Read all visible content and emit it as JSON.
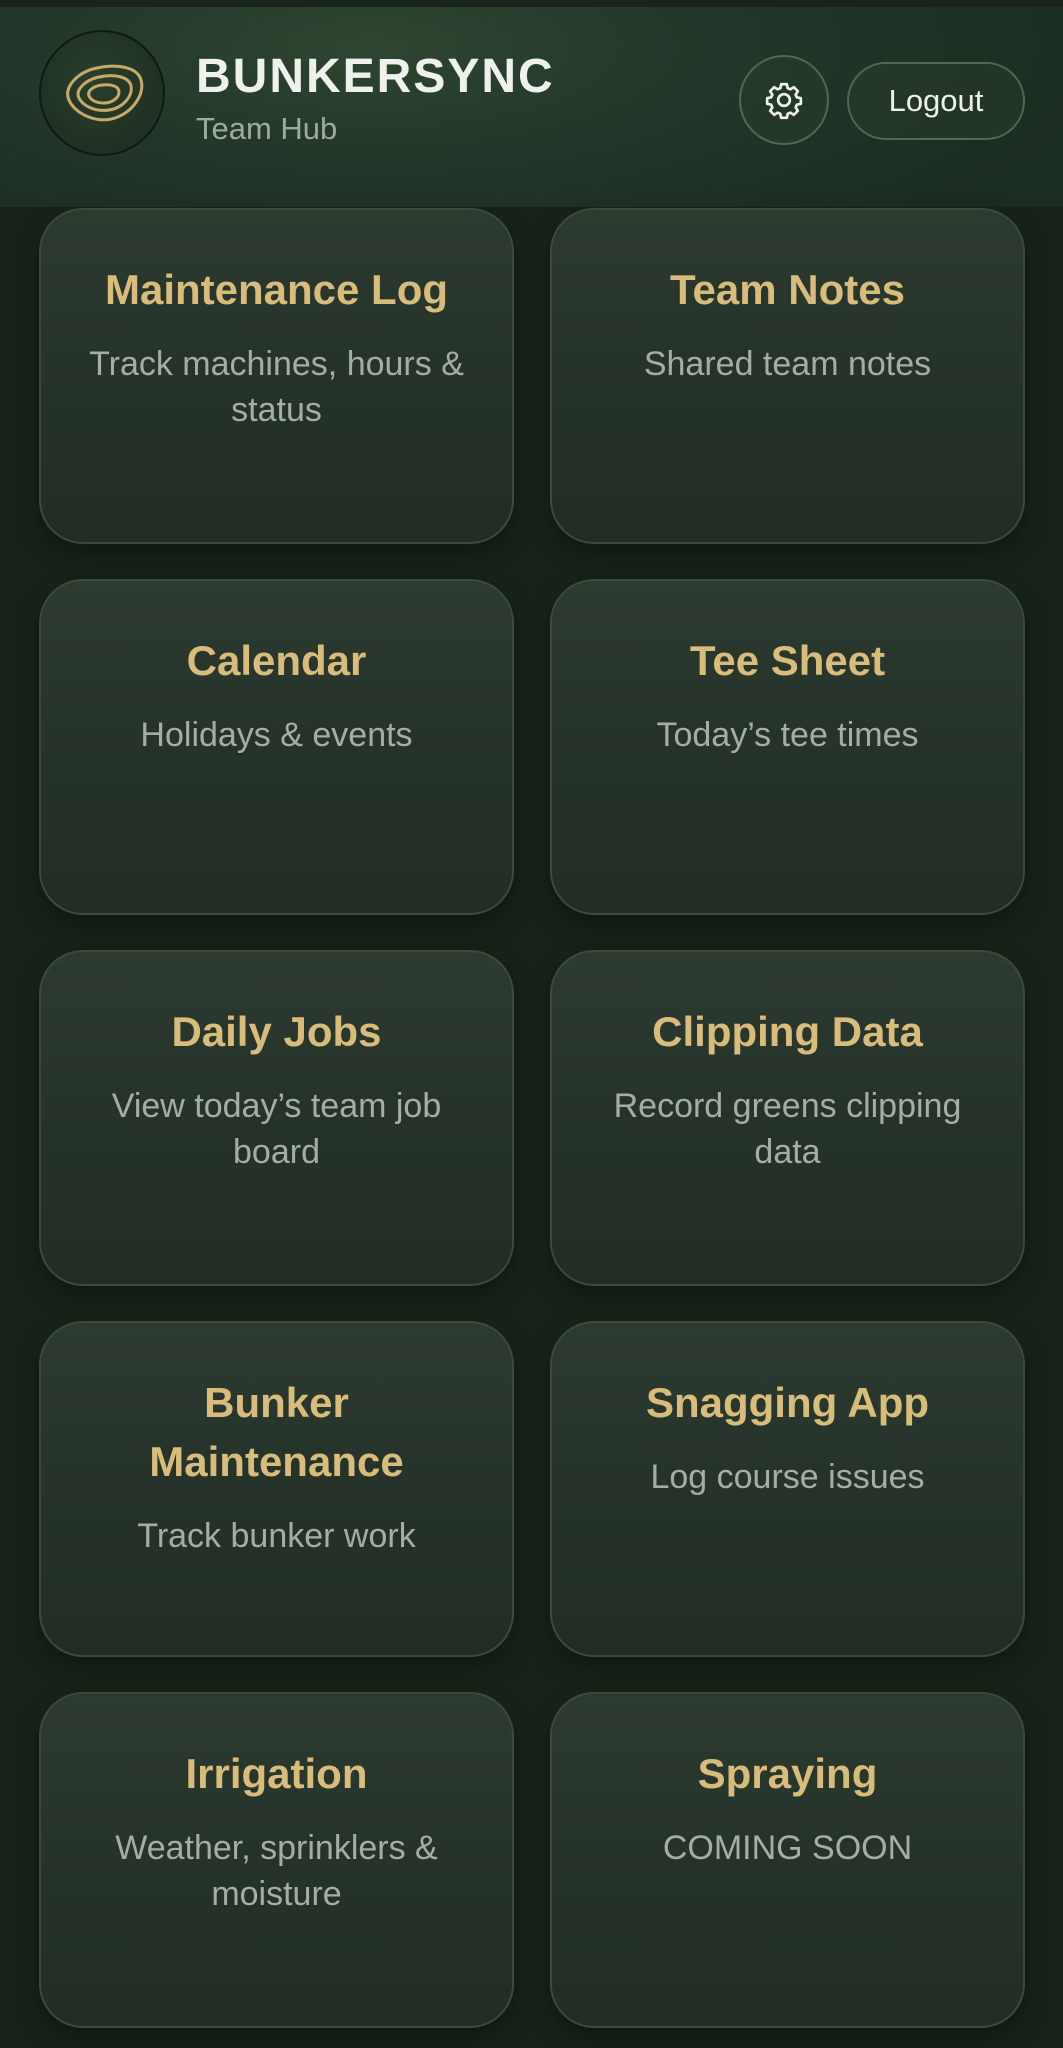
{
  "header": {
    "app_name": "BUNKERSYNC",
    "subtitle": "Team Hub",
    "logo_icon": "bunker-contour-icon",
    "settings_icon": "gear-icon",
    "logout_label": "Logout"
  },
  "colors": {
    "background": "#172319",
    "card_title": "#d8bc7c",
    "card_text": "#a6ada3",
    "header_title": "#eef1ec"
  },
  "cards": [
    {
      "title": "Maintenance Log",
      "description": "Track machines, hours & status"
    },
    {
      "title": "Team Notes",
      "description": "Shared team notes"
    },
    {
      "title": "Calendar",
      "description": "Holidays & events"
    },
    {
      "title": "Tee Sheet",
      "description": "Today’s tee times"
    },
    {
      "title": "Daily Jobs",
      "description": "View today’s team job board"
    },
    {
      "title": "Clipping Data",
      "description": "Record greens clipping data"
    },
    {
      "title": "Bunker Maintenance",
      "description": "Track bunker work"
    },
    {
      "title": "Snagging App",
      "description": "Log course issues"
    },
    {
      "title": "Irrigation",
      "description": "Weather, sprinklers & moisture"
    },
    {
      "title": "Spraying",
      "description": "COMING SOON"
    }
  ]
}
